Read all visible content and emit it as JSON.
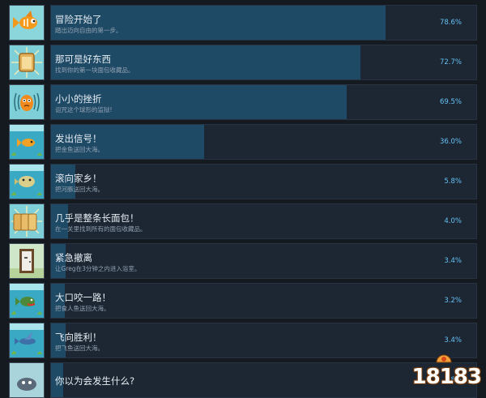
{
  "colors": {
    "background": "#151a21",
    "bar": "#1c2733",
    "fill": "#1f4a66",
    "percent": "#66c0f4"
  },
  "achievements": [
    {
      "icon": "fish-icon",
      "title": "冒险开始了",
      "description": "踏出迈向自由的第一步。",
      "percent_label": "78.6%",
      "percent": 78.6
    },
    {
      "icon": "toast-icon",
      "title": "那可是好东西",
      "description": "找到你的第一块面包收藏品。",
      "percent_label": "72.7%",
      "percent": 72.7
    },
    {
      "icon": "struggling-fish-icon",
      "title": "小小的挫折",
      "description": "诅咒这个球形的监狱!",
      "percent_label": "69.5%",
      "percent": 69.5
    },
    {
      "icon": "fish-underwater-icon",
      "title": "发出信号！",
      "description": "把金鱼送回大海。",
      "percent_label": "36.0%",
      "percent": 36.0
    },
    {
      "icon": "pufferfish-icon",
      "title": "滚向家乡！",
      "description": "把河豚送回大海。",
      "percent_label": "5.8%",
      "percent": 5.8
    },
    {
      "icon": "bread-loaf-icon",
      "title": "几乎是整条长面包！",
      "description": "在一关里找到所有的面包收藏品。",
      "percent_label": "4.0%",
      "percent": 4.0
    },
    {
      "icon": "door-icon",
      "title": "紧急撤离",
      "description": "让Greg在3分钟之内进入浴室。",
      "percent_label": "3.4%",
      "percent": 3.4
    },
    {
      "icon": "piranha-icon",
      "title": "大口咬一路！",
      "description": "把食人鱼送回大海。",
      "percent_label": "3.2%",
      "percent": 3.2
    },
    {
      "icon": "flying-fish-icon",
      "title": "飞向胜利！",
      "description": "把飞鱼送回大海。",
      "percent_label": "3.4%",
      "percent": 3.4
    },
    {
      "icon": "mystery-icon",
      "title": "你以为会发生什么?",
      "description": "",
      "percent_label": "2.8%",
      "percent": 2.8
    }
  ],
  "watermark": {
    "text": "18183"
  }
}
